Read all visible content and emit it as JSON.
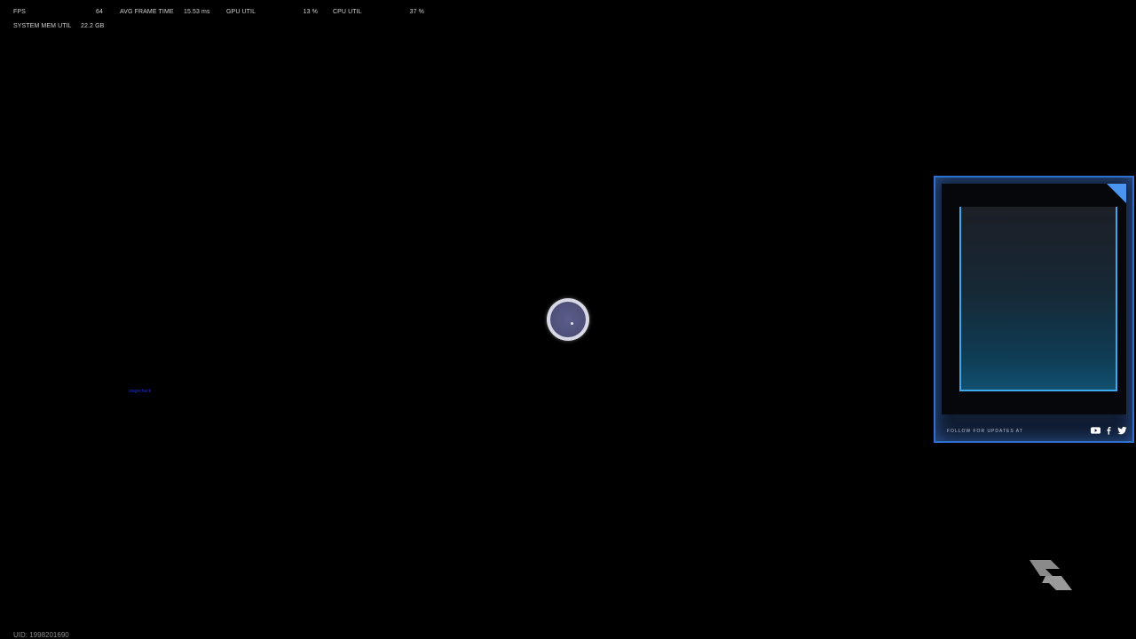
{
  "perf": {
    "fps_label": "FPS",
    "fps_value": "64",
    "avg_frame_label": "AVG FRAME TIME",
    "avg_frame_value": "15.53 ms",
    "gpu_label": "GPU UTIL",
    "gpu_value": "13 %",
    "cpu_label": "CPU UTIL",
    "cpu_value": "37 %",
    "mem_label": "SYSTEM MEM UTIL",
    "mem_value": "22.2 GB"
  },
  "blue_text": "stagecheck",
  "promo": {
    "footer_text": "FOLLOW FOR UPDATES AT",
    "socials": [
      "youtube-icon",
      "facebook-icon",
      "twitter-icon"
    ]
  },
  "uid": "UID: 1998201690",
  "colors": {
    "background": "#000000",
    "accent_blue": "#2f6fd0",
    "spinner_fill": "#50527c"
  }
}
